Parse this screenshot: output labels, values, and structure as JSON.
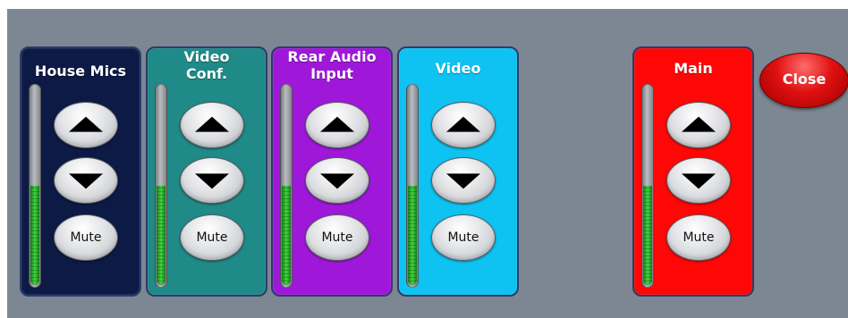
{
  "strips": [
    {
      "id": "house-mics",
      "title": "House Mics",
      "color": "#0c1a45",
      "level": 0.5,
      "mute_label": "Mute"
    },
    {
      "id": "video-conf",
      "title": "Video\nConf.",
      "color": "#1f8a88",
      "level": 0.5,
      "mute_label": "Mute"
    },
    {
      "id": "rear-audio-input",
      "title": "Rear Audio\nInput",
      "color": "#9f18d9",
      "level": 0.5,
      "mute_label": "Mute"
    },
    {
      "id": "video",
      "title": "Video",
      "color": "#0ec2f2",
      "level": 0.5,
      "mute_label": "Mute"
    },
    {
      "id": "main",
      "title": "Main",
      "color": "#ff0707",
      "level": 0.5,
      "mute_label": "Mute"
    }
  ],
  "icons": {
    "volume_up": "up-triangle",
    "volume_down": "down-triangle"
  },
  "close_label": "Close",
  "colors": {
    "panel_background": "#7c8793",
    "close_button": "#e01010",
    "meter_green": "#3fd43f"
  }
}
